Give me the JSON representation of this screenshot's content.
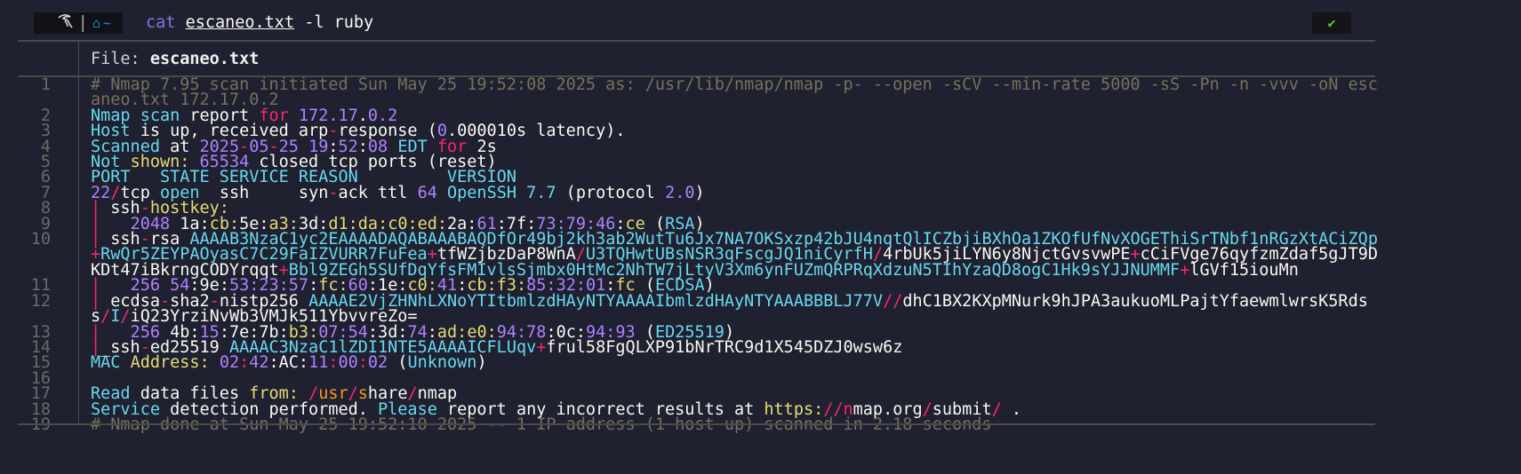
{
  "prompt": {
    "home_label": "~",
    "command": "cat",
    "file_arg": "escaneo.txt",
    "args": " -l ruby",
    "status_icon": "✔"
  },
  "header": {
    "label": "File: ",
    "filename": "escaneo.txt"
  },
  "colors": {
    "cyan": "#66d9ef",
    "pink": "#f92672",
    "purple": "#ae81ff",
    "yellow": "#e6db74",
    "white": "#f8f8f2",
    "comment": "#75715e",
    "orange": "#fd971f"
  },
  "lines": [
    {
      "n": "1",
      "t": [
        [
          "g",
          "# Nmap 7.95 scan initiated Sun May 25 19:52:08 2025 as: /usr/lib/nmap/nmap -p- --open -sCV --min-rate 5000 -sS -Pn -n -vvv -oN escaneo.txt 172.17.0.2"
        ]
      ]
    },
    {
      "n": "2",
      "t": [
        [
          "c",
          "Nmap scan"
        ],
        [
          "w",
          " report "
        ],
        [
          "p",
          "for"
        ],
        [
          "w",
          " "
        ],
        [
          "v",
          "172.17"
        ],
        [
          "w",
          "."
        ],
        [
          "v",
          "0.2"
        ]
      ]
    },
    {
      "n": "3",
      "t": [
        [
          "c",
          "Host"
        ],
        [
          "w",
          " is up, received arp"
        ],
        [
          "p",
          "-"
        ],
        [
          "w",
          "response ("
        ],
        [
          "v",
          "0"
        ],
        [
          "w",
          ".000010s latency)."
        ]
      ]
    },
    {
      "n": "4",
      "t": [
        [
          "c",
          "Scanned"
        ],
        [
          "w",
          " at "
        ],
        [
          "v",
          "2025"
        ],
        [
          "p",
          "-"
        ],
        [
          "v",
          "05"
        ],
        [
          "p",
          "-"
        ],
        [
          "v",
          "25 19"
        ],
        [
          "w",
          ":"
        ],
        [
          "v",
          "52"
        ],
        [
          "w",
          ":"
        ],
        [
          "v",
          "08"
        ],
        [
          "w",
          " "
        ],
        [
          "c",
          "EDT"
        ],
        [
          "w",
          " "
        ],
        [
          "p",
          "for"
        ],
        [
          "w",
          " 2s"
        ]
      ]
    },
    {
      "n": "5",
      "t": [
        [
          "c",
          "Not "
        ],
        [
          "y",
          "shown:"
        ],
        [
          "w",
          " "
        ],
        [
          "v",
          "65534"
        ],
        [
          "w",
          " closed tcp ports (reset)"
        ]
      ]
    },
    {
      "n": "6",
      "t": [
        [
          "c",
          "PORT   STATE SERVICE REASON         VERSION"
        ]
      ]
    },
    {
      "n": "7",
      "t": [
        [
          "v",
          "22"
        ],
        [
          "p",
          "/"
        ],
        [
          "w",
          "tcp "
        ],
        [
          "c",
          "open"
        ],
        [
          "w",
          "  ssh     syn"
        ],
        [
          "p",
          "-"
        ],
        [
          "w",
          "ack ttl "
        ],
        [
          "v",
          "64"
        ],
        [
          "w",
          " "
        ],
        [
          "c",
          "OpenSSH 7.7"
        ],
        [
          "w",
          " (protocol "
        ],
        [
          "v",
          "2.0"
        ],
        [
          "w",
          ")"
        ]
      ]
    },
    {
      "n": "8",
      "t": [
        [
          "p",
          "|"
        ],
        [
          "w",
          " ssh"
        ],
        [
          "p",
          "-"
        ],
        [
          "y",
          "hostkey:"
        ]
      ]
    },
    {
      "n": "9",
      "t": [
        [
          "p",
          "|"
        ],
        [
          "w",
          "   "
        ],
        [
          "v",
          "2048"
        ],
        [
          "w",
          " 1a:"
        ],
        [
          "y",
          "cb:"
        ],
        [
          "w",
          "5e:"
        ],
        [
          "y",
          "a3:"
        ],
        [
          "w",
          "3d:"
        ],
        [
          "y",
          "d1:da:c0:ed:"
        ],
        [
          "w",
          "2a:"
        ],
        [
          "v",
          "61"
        ],
        [
          "w",
          ":7f:"
        ],
        [
          "v",
          "73:79:46"
        ],
        [
          "w",
          ":"
        ],
        [
          "y",
          "ce"
        ],
        [
          "w",
          " ("
        ],
        [
          "c",
          "RSA"
        ],
        [
          "w",
          ")"
        ]
      ]
    },
    {
      "n": "10",
      "t": [
        [
          "p",
          "|"
        ],
        [
          "w",
          " ssh"
        ],
        [
          "p",
          "-"
        ],
        [
          "w",
          "rsa "
        ],
        [
          "c",
          "AAAAB3NzaC1yc2EAAAADAQABAAABAQDfOr49bj2kh3ab2WutTu6Jx7NA7OKSxzp42bJU4nqtQlICZbjiBXhOa1ZKOfUfNvXOGEThiSrTNbf1nRGzXtACiZQp"
        ],
        [
          "p",
          "+"
        ],
        [
          "c",
          "RwQr5ZEYPAOyasC7C29FaIZVURR7FuFea"
        ],
        [
          "p",
          "+"
        ],
        [
          "w",
          "tfWZjbzDaP8WnA"
        ],
        [
          "p",
          "/"
        ],
        [
          "c",
          "U3TQHwtUBsNSR3qFscgJQ1niCyrfH"
        ],
        [
          "p",
          "/"
        ],
        [
          "w",
          "4rbUk5jiLYN6y8NjctGvsvwPE"
        ],
        [
          "p",
          "+"
        ],
        [
          "w",
          "cCiFVge76qyfzmZdaf5gJT9DKDt47iBkrngCODYrqqt"
        ],
        [
          "p",
          "+"
        ],
        [
          "c",
          "Bbl9ZEGh5SUfDqYfsFMIvlsSjmbx0HtMc2NhTW7jLtyV3Xm6ynFUZmQRPRqXdzuN5TIhYzaQD8ogC1Hk9sYJJNUMMF"
        ],
        [
          "p",
          "+"
        ],
        [
          "w",
          "lGVf15iouMn"
        ]
      ]
    },
    {
      "n": "11",
      "t": [
        [
          "p",
          "|"
        ],
        [
          "w",
          "   "
        ],
        [
          "v",
          "256"
        ],
        [
          "w",
          " "
        ],
        [
          "v",
          "54"
        ],
        [
          "w",
          ":9e:"
        ],
        [
          "v",
          "53:23:57"
        ],
        [
          "w",
          ":"
        ],
        [
          "y",
          "fc:"
        ],
        [
          "v",
          "60"
        ],
        [
          "w",
          ":1e:"
        ],
        [
          "y",
          "c0:"
        ],
        [
          "v",
          "41"
        ],
        [
          "w",
          ":"
        ],
        [
          "y",
          "cb:f3:"
        ],
        [
          "v",
          "85:32:01"
        ],
        [
          "w",
          ":"
        ],
        [
          "y",
          "fc"
        ],
        [
          "w",
          " ("
        ],
        [
          "c",
          "ECDSA"
        ],
        [
          "w",
          ")"
        ]
      ]
    },
    {
      "n": "12",
      "t": [
        [
          "p",
          "|"
        ],
        [
          "w",
          " ecdsa"
        ],
        [
          "p",
          "-"
        ],
        [
          "w",
          "sha2"
        ],
        [
          "p",
          "-"
        ],
        [
          "w",
          "nistp256 "
        ],
        [
          "c",
          "AAAAE2VjZHNhLXNoYTItbmlzdHAyNTYAAAAIbmlzdHAyNTYAAABBBLJ77V"
        ],
        [
          "p",
          "//"
        ],
        [
          "w",
          "dhC1BX2KXpMNurk9hJPA3aukuoMLPajtYfaewmlwrsK5Rdss"
        ],
        [
          "p",
          "/"
        ],
        [
          "c",
          "I"
        ],
        [
          "p",
          "/"
        ],
        [
          "w",
          "iQ23YrziNvWb3VMJk511YbvvreZo="
        ]
      ]
    },
    {
      "n": "13",
      "t": [
        [
          "p",
          "|"
        ],
        [
          "w",
          "   "
        ],
        [
          "v",
          "256"
        ],
        [
          "w",
          " 4b:"
        ],
        [
          "v",
          "15"
        ],
        [
          "w",
          ":7e:7b:"
        ],
        [
          "y",
          "b3:"
        ],
        [
          "v",
          "07:54"
        ],
        [
          "w",
          ":3d:"
        ],
        [
          "v",
          "74"
        ],
        [
          "w",
          ":"
        ],
        [
          "y",
          "ad:e0:"
        ],
        [
          "v",
          "94:78"
        ],
        [
          "w",
          ":0c:"
        ],
        [
          "v",
          "94:93"
        ],
        [
          "w",
          " ("
        ],
        [
          "c",
          "ED25519"
        ],
        [
          "w",
          ")"
        ]
      ]
    },
    {
      "n": "14",
      "t": [
        [
          "p",
          "|"
        ],
        [
          "w",
          "_ssh"
        ],
        [
          "p",
          "-"
        ],
        [
          "w",
          "ed25519 "
        ],
        [
          "c",
          "AAAAC3NzaC1lZDI1NTE5AAAAICFLUqv"
        ],
        [
          "p",
          "+"
        ],
        [
          "w",
          "frul58FgQLXP91bNrTRC9d1X545DZJ0wsw6z"
        ]
      ]
    },
    {
      "n": "15",
      "t": [
        [
          "c",
          "MAC "
        ],
        [
          "y",
          "Address:"
        ],
        [
          "w",
          " "
        ],
        [
          "v",
          "02"
        ],
        [
          "p",
          ":"
        ],
        [
          "v",
          "42"
        ],
        [
          "w",
          ":AC:"
        ],
        [
          "v",
          "11"
        ],
        [
          "p",
          ":"
        ],
        [
          "v",
          "00"
        ],
        [
          "p",
          ":"
        ],
        [
          "v",
          "02"
        ],
        [
          "w",
          " ("
        ],
        [
          "c",
          "Unknown"
        ],
        [
          "w",
          ")"
        ]
      ]
    },
    {
      "n": "16",
      "t": []
    },
    {
      "n": "17",
      "t": [
        [
          "c",
          "Read"
        ],
        [
          "w",
          " data files "
        ],
        [
          "y",
          "from:"
        ],
        [
          "w",
          " "
        ],
        [
          "p",
          "/"
        ],
        [
          "o",
          "usr"
        ],
        [
          "p",
          "/"
        ],
        [
          "o",
          "s"
        ],
        [
          "w",
          "hare"
        ],
        [
          "p",
          "/"
        ],
        [
          "w",
          "nmap"
        ]
      ]
    },
    {
      "n": "18",
      "t": [
        [
          "c",
          "Service"
        ],
        [
          "w",
          " detection performed. "
        ],
        [
          "c",
          "Please"
        ],
        [
          "w",
          " report any incorrect results at "
        ],
        [
          "y",
          "https:"
        ],
        [
          "p",
          "//n"
        ],
        [
          "w",
          "map.org"
        ],
        [
          "p",
          "/"
        ],
        [
          "w",
          "submit"
        ],
        [
          "p",
          "/"
        ],
        [
          "w",
          " ."
        ]
      ]
    },
    {
      "n": "19",
      "t": [
        [
          "g",
          "# Nmap done at Sun May 25 19:52:10 2025 -- 1 IP address (1 host up) scanned in 2.18 seconds"
        ]
      ]
    }
  ]
}
